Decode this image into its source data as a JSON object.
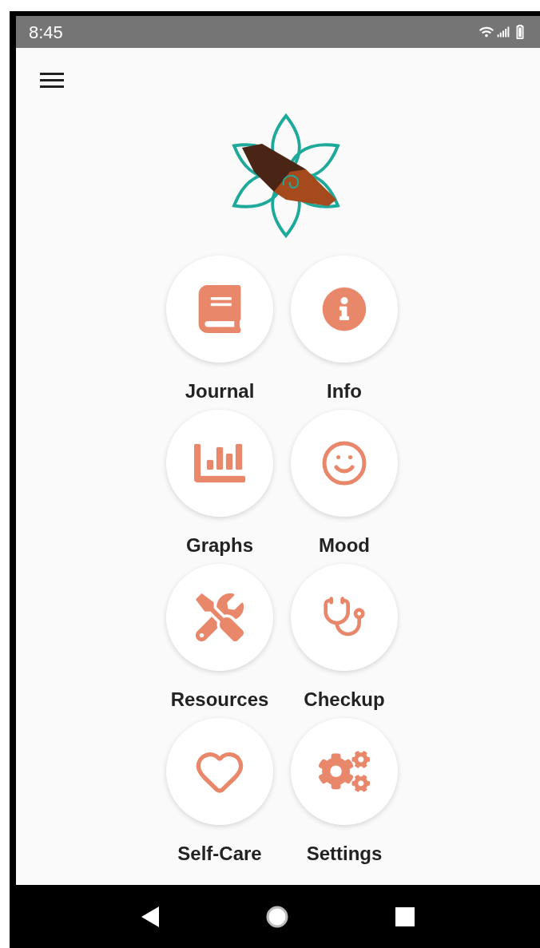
{
  "status_bar": {
    "time": "8:45"
  },
  "tiles": [
    {
      "label": "Journal",
      "kind": "book"
    },
    {
      "label": "Info",
      "kind": "info"
    },
    {
      "label": "Graphs",
      "kind": "chart"
    },
    {
      "label": "Mood",
      "kind": "smile"
    },
    {
      "label": "Resources",
      "kind": "tools"
    },
    {
      "label": "Checkup",
      "kind": "stethoscope"
    },
    {
      "label": "Self-Care",
      "kind": "heart"
    },
    {
      "label": "Settings",
      "kind": "gears"
    }
  ]
}
